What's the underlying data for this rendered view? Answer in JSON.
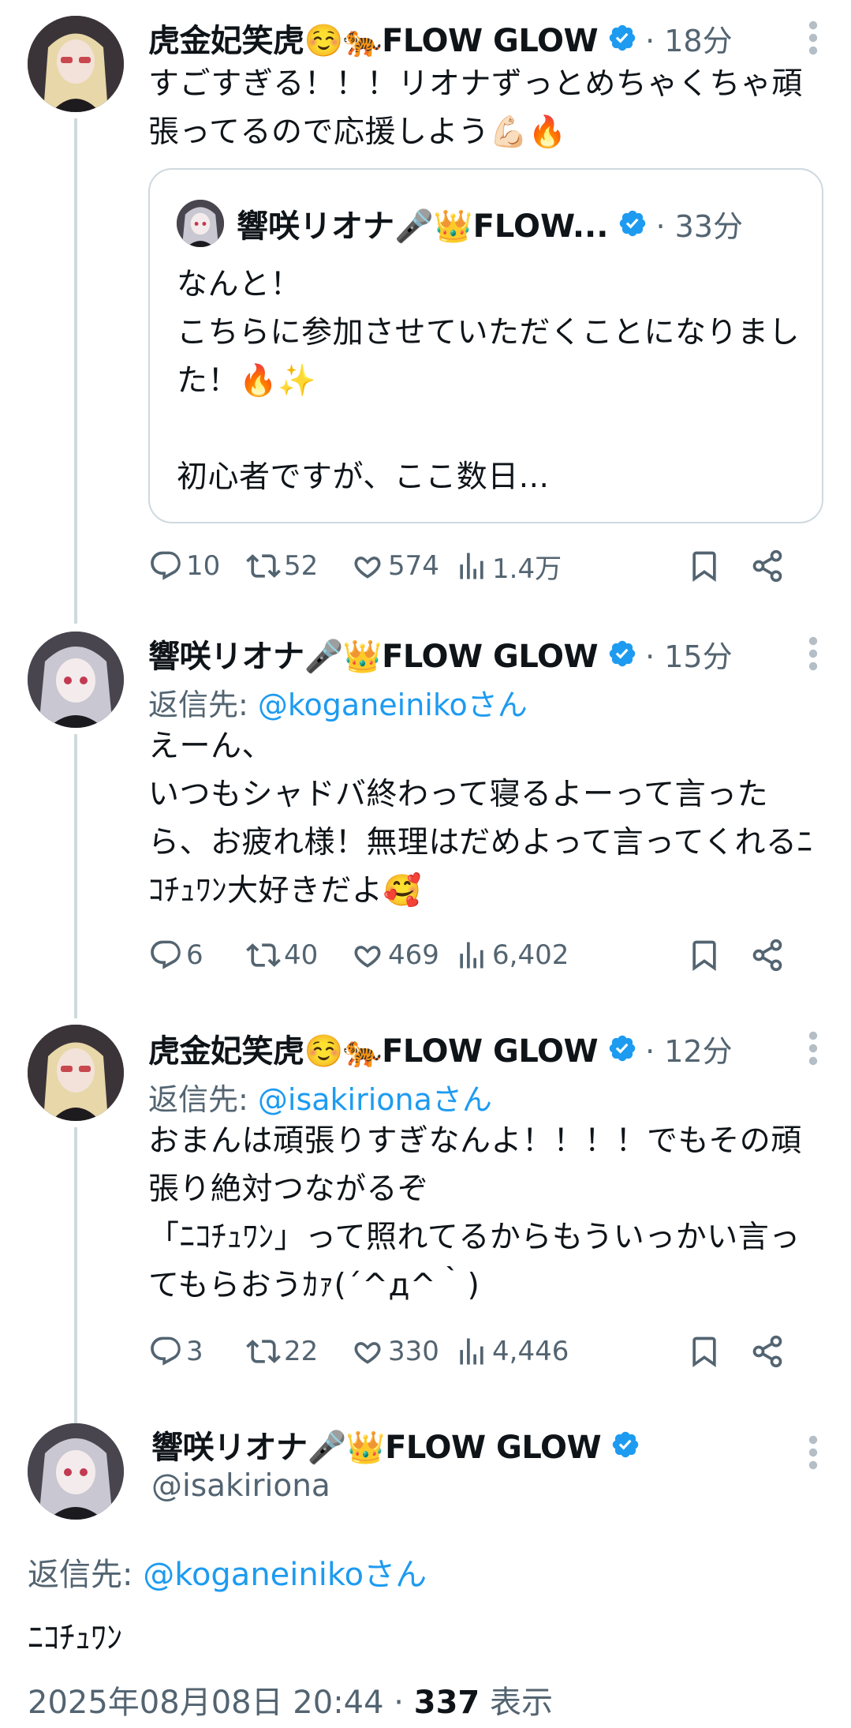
{
  "thread": [
    {
      "name": "虎金妃笑虎☺️🐅FLOW GLOW",
      "time": "· 18分",
      "text": "すごすぎる！！！リオナずっとめちゃくちゃ頑張ってるので応援しよう💪🏻🔥",
      "quote": {
        "name": "響咲リオナ🎤👑FLOW...",
        "time": "· 33分",
        "text": "なんと！\nこちらに参加させていただくことになりました！🔥✨\n\n初心者ですが、ここ数日..."
      },
      "stats": {
        "replies": "10",
        "retweets": "52",
        "likes": "574",
        "views": "1.4万"
      }
    },
    {
      "name": "響咲リオナ🎤👑FLOW GLOW",
      "time": "· 15分",
      "reply_prefix": "返信先: ",
      "reply_to": "@koganeinikoさん",
      "text": "えーん、\nいつもシャドバ終わって寝るよーって言ったら、お疲れ様！無理はだめよって言ってくれるﾆｺﾁｭﾜﾝ大好きだよ🥰",
      "stats": {
        "replies": "6",
        "retweets": "40",
        "likes": "469",
        "views": "6,402"
      }
    },
    {
      "name": "虎金妃笑虎☺️🐅FLOW GLOW",
      "time": "· 12分",
      "reply_prefix": "返信先: ",
      "reply_to": "@isakirionaさん",
      "text": "おまんは頑張りすぎなんよ！！！！でもその頑張り絶対つながるぞ\n「ﾆｺﾁｭﾜﾝ」って照れてるからもういっかい言ってもらおうｶｧ(´^д^｀)",
      "stats": {
        "replies": "3",
        "retweets": "22",
        "likes": "330",
        "views": "4,446"
      }
    }
  ],
  "main": {
    "name": "響咲リオナ🎤👑FLOW GLOW",
    "handle": "@isakiriona",
    "reply_prefix": "返信先: ",
    "reply_to": "@koganeinikoさん",
    "text": "ﾆｺﾁｭﾜﾝ",
    "date": "2025年08月08日 20:44 · ",
    "views_count": "337",
    "views_label": " 表示"
  },
  "colors": {
    "accent": "#1d9bf0",
    "muted": "#536471",
    "text": "#0f1419",
    "line": "#cfd9de"
  }
}
